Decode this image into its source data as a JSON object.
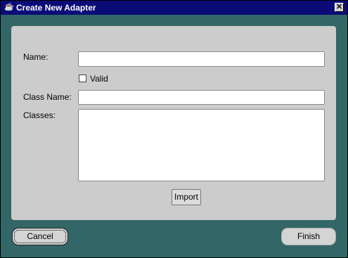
{
  "window": {
    "title": "Create New Adapter",
    "icon": "java-cup-icon",
    "close_glyph": "✕"
  },
  "form": {
    "name_label": "Name:",
    "name_value": "",
    "valid_label": "Valid",
    "valid_checked": false,
    "class_name_label": "Class Name:",
    "class_name_value": "",
    "classes_label": "Classes:",
    "classes_items": []
  },
  "buttons": {
    "import_label": "Import",
    "cancel_label": "Cancel",
    "finish_label": "Finish"
  },
  "colors": {
    "titlebar": "#0b0b78",
    "background": "#336666",
    "panel": "#cccccc"
  }
}
